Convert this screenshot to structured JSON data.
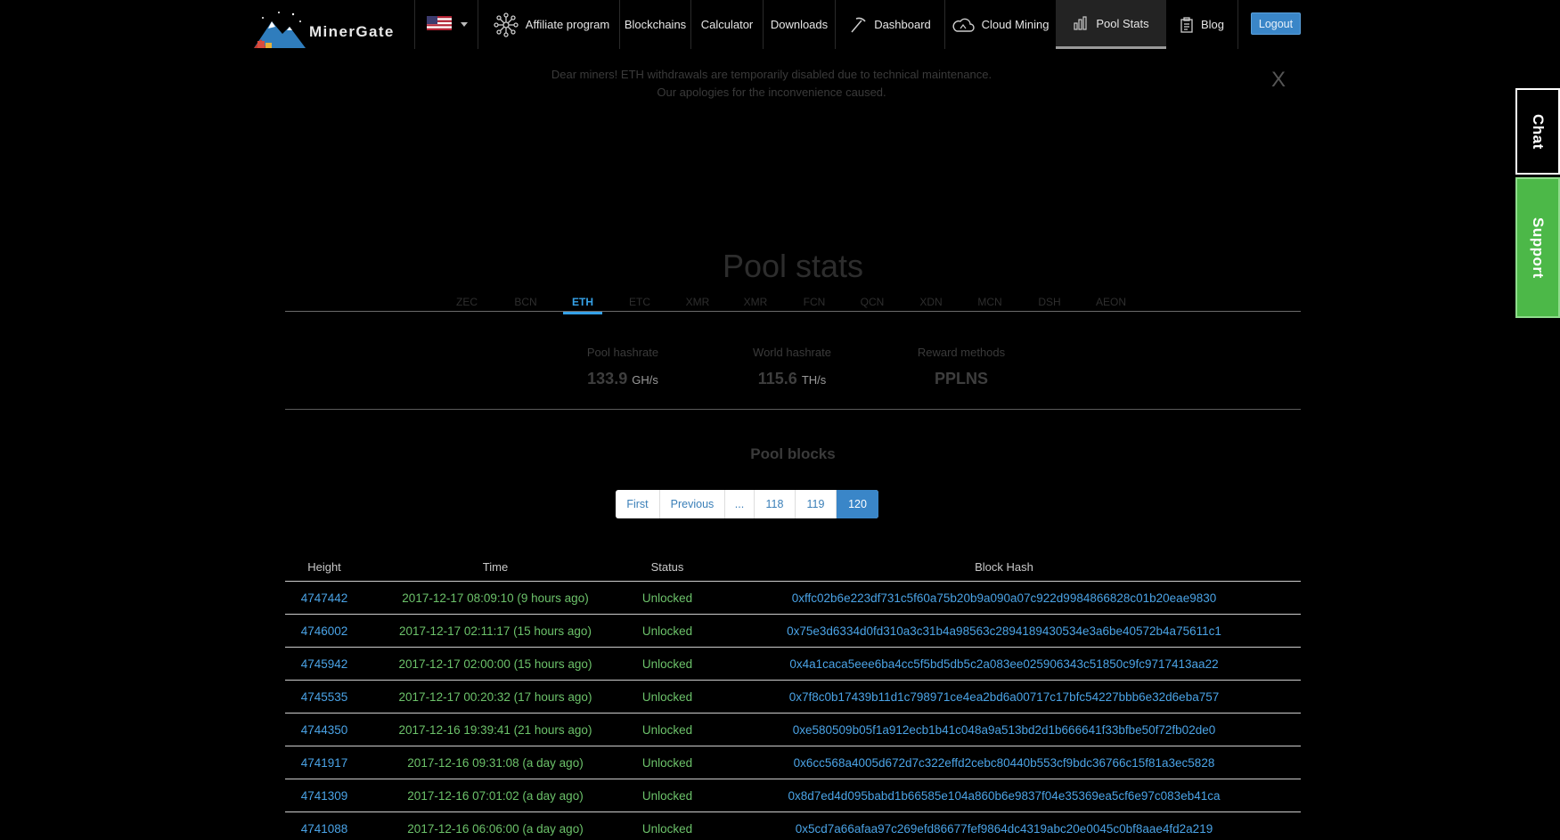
{
  "brand": {
    "name": "MinerGate"
  },
  "nav": {
    "affiliate": "Affiliate program",
    "blockchains": "Blockchains",
    "calculator": "Calculator",
    "downloads": "Downloads",
    "dashboard": "Dashboard",
    "cloud_mining": "Cloud Mining",
    "pool_stats": "Pool Stats",
    "blog": "Blog",
    "logout": "Logout",
    "active": "pool_stats"
  },
  "side": {
    "chat": "Chat",
    "support": "Support"
  },
  "notice": {
    "line1": "Dear miners! ETH withdrawals are temporarily disabled due to technical maintenance.",
    "line2": "Our apologies for the inconvenience caused.",
    "close": "X"
  },
  "page": {
    "title": "Pool stats"
  },
  "coin_tabs": [
    "ZEC",
    "BCN",
    "ETH",
    "ETC",
    "XMR",
    "XMR",
    "FCN",
    "QCN",
    "XDN",
    "MCN",
    "DSH",
    "AEON"
  ],
  "coin_tab_active": "ETH",
  "stats": {
    "pool_hashrate": {
      "label": "Pool hashrate",
      "value": "133.9",
      "unit": "GH/s"
    },
    "world_hashrate": {
      "label": "World hashrate",
      "value": "115.6",
      "unit": "TH/s"
    },
    "reward_methods": {
      "label": "Reward methods",
      "value": "PPLNS"
    }
  },
  "blocks": {
    "title": "Pool blocks",
    "pagination": {
      "first": "First",
      "previous": "Previous",
      "ellipsis": "...",
      "p1": "118",
      "p2": "119",
      "p3": "120",
      "current": "120"
    },
    "columns": {
      "height": "Height",
      "time": "Time",
      "status": "Status",
      "hash": "Block Hash"
    },
    "rows": [
      {
        "height": "4747442",
        "time": "2017-12-17 08:09:10 (9 hours ago)",
        "status": "Unlocked",
        "hash": "0xffc02b6e223df731c5f60a75b20b9a090a07c922d9984866828c01b20eae9830"
      },
      {
        "height": "4746002",
        "time": "2017-12-17 02:11:17 (15 hours ago)",
        "status": "Unlocked",
        "hash": "0x75e3d6334d0fd310a3c31b4a98563c2894189430534e3a6be40572b4a75611c1"
      },
      {
        "height": "4745942",
        "time": "2017-12-17 02:00:00 (15 hours ago)",
        "status": "Unlocked",
        "hash": "0x4a1caca5eee6ba4cc5f5bd5db5c2a083ee025906343c51850c9fc9717413aa22"
      },
      {
        "height": "4745535",
        "time": "2017-12-17 00:20:32 (17 hours ago)",
        "status": "Unlocked",
        "hash": "0x7f8c0b17439b11d1c798971ce4ea2bd6a00717c17bfc54227bbb6e32d6eba757"
      },
      {
        "height": "4744350",
        "time": "2017-12-16 19:39:41 (21 hours ago)",
        "status": "Unlocked",
        "hash": "0xe580509b05f1a912ecb1b41c048a9a513bd2d1b666641f33bfbe50f72fb02de0"
      },
      {
        "height": "4741917",
        "time": "2017-12-16 09:31:08 (a day ago)",
        "status": "Unlocked",
        "hash": "0x6cc568a4005d672d7c322effd2cebc80440b553cf9bdc36766c15f81a3ec5828"
      },
      {
        "height": "4741309",
        "time": "2017-12-16 07:01:02 (a day ago)",
        "status": "Unlocked",
        "hash": "0x8d7ed4d095babd1b66585e104a860b6e9837f04e35369ea5cf6e97c083eb41ca"
      },
      {
        "height": "4741088",
        "time": "2017-12-16 06:06:00 (a day ago)",
        "status": "Unlocked",
        "hash": "0x5cd7a66afaa97c269efd86677fef9864dc4319abc20e0045c0bf8aae4fd2a219"
      }
    ]
  },
  "icons": {
    "affiliate": "network-icon",
    "dashboard": "pickaxe-icon",
    "cloud_mining": "cloud-icon",
    "pool_stats": "bar-chart-icon",
    "blog": "clipboard-icon",
    "flag": "us-flag-icon"
  },
  "colors": {
    "accent": "#3a86c8",
    "link": "#4aa3e6",
    "success": "#6cc26a",
    "support": "#4cb848",
    "active_tab": "#36a2e8"
  }
}
